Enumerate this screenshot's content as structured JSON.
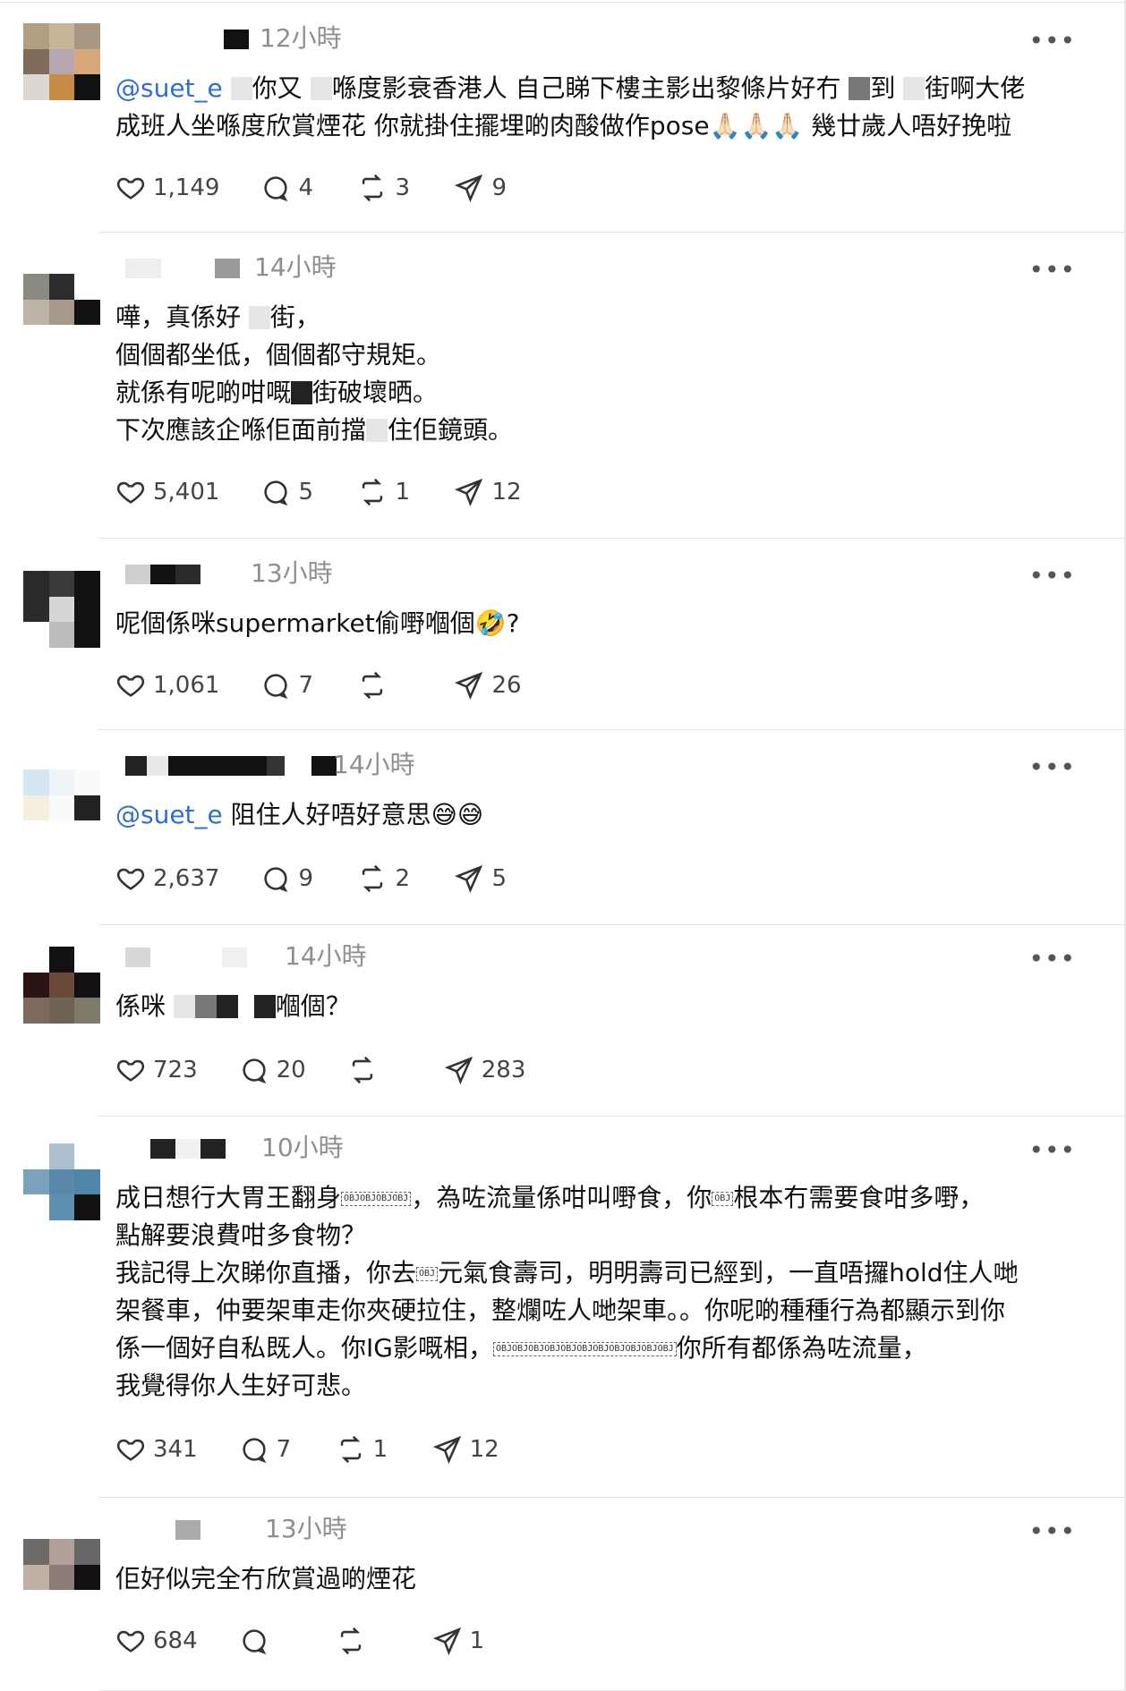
{
  "posts": [
    {
      "time": "12小時",
      "text_parts": [
        {
          "t": "@suet_e",
          "mention": true
        },
        {
          "t": " "
        },
        {
          "censor": "light"
        },
        {
          "t": "你又 "
        },
        {
          "censor": "light"
        },
        {
          "t": "喺度影衰香港人 自己睇下樓主影出黎條片好冇 "
        },
        {
          "censor": "grey"
        },
        {
          "t": "到 "
        },
        {
          "censor": "light"
        },
        {
          "t": "街啊大佬\n成班人坐喺度欣賞煙花 你就掛住擺埋啲肉酸做作pose🙏🏻🙏🏻🙏🏻 幾廿歲人唔好挽啦"
        }
      ],
      "likes": "1,149",
      "replies": "4",
      "reposts": "3",
      "shares": "9"
    },
    {
      "time": "14小時",
      "text_parts": [
        {
          "t": "嘩，真係好 "
        },
        {
          "censor": "light"
        },
        {
          "t": "街，\n個個都坐低，個個都守規矩。\n就係有呢啲咁嘅"
        },
        {
          "censor": "dark"
        },
        {
          "t": "街破壞晒。\n下次應該企喺佢面前擋"
        },
        {
          "censor": "light"
        },
        {
          "t": "住佢鏡頭。"
        }
      ],
      "likes": "5,401",
      "replies": "5",
      "reposts": "1",
      "shares": "12"
    },
    {
      "time": "13小時",
      "text_parts": [
        {
          "t": "呢個係咪supermarket偷嘢嗰個🤣?"
        }
      ],
      "likes": "1,061",
      "replies": "7",
      "reposts": "",
      "shares": "26"
    },
    {
      "time": "14小時",
      "text_parts": [
        {
          "t": "@suet_e",
          "mention": true
        },
        {
          "t": " 阻住人好唔好意思😅😅"
        }
      ],
      "likes": "2,637",
      "replies": "9",
      "reposts": "2",
      "shares": "5"
    },
    {
      "time": "14小時",
      "text_parts": [
        {
          "t": "係咪 "
        },
        {
          "censor": "light"
        },
        {
          "censor": "grey"
        },
        {
          "censor": "dark"
        },
        {
          "t": "  "
        },
        {
          "censor": "dark"
        },
        {
          "t": "嗰個？"
        }
      ],
      "likes": "723",
      "replies": "20",
      "reposts": "",
      "shares": "283"
    },
    {
      "time": "10小時",
      "text_parts": [
        {
          "t": "成日想行大胃王翻身"
        },
        {
          "obj": "OBJOBJOBJOBJ"
        },
        {
          "t": "，為咗流量係咁叫嘢食，你"
        },
        {
          "obj": "OBJ"
        },
        {
          "t": "根本冇需要食咁多嘢，\n點解要浪費咁多食物？\n我記得上次睇你直播，你去"
        },
        {
          "obj": "OBJ"
        },
        {
          "t": "元氣食壽司，明明壽司已經到，一直唔攞hold住人哋\n架餐車，仲要架車走你夾硬拉住，整爛咗人哋架車。。你呢啲種種行為都顯示到你\n係一個好自私既人。你IG影嘅相，"
        },
        {
          "obj": "OBJOBJOBJOBJOBJOBJOBJOBJOBJOBJOBJ"
        },
        {
          "t": "你所有都係為咗流量，\n我覺得你人生好可悲。"
        }
      ],
      "likes": "341",
      "replies": "7",
      "reposts": "1",
      "shares": "12"
    },
    {
      "time": "13小時",
      "text_parts": [
        {
          "t": "佢好似完全冇欣賞過啲煙花"
        }
      ],
      "likes": "684",
      "replies": "",
      "reposts": "",
      "shares": "1"
    }
  ],
  "icons": {
    "more": "more-icon",
    "like": "heart-icon",
    "reply": "reply-icon",
    "repost": "repost-icon",
    "share": "share-icon"
  },
  "colors": {
    "mention": "#2a6fd6",
    "time": "#8e8e8e",
    "divider": "#e4e4e4"
  }
}
